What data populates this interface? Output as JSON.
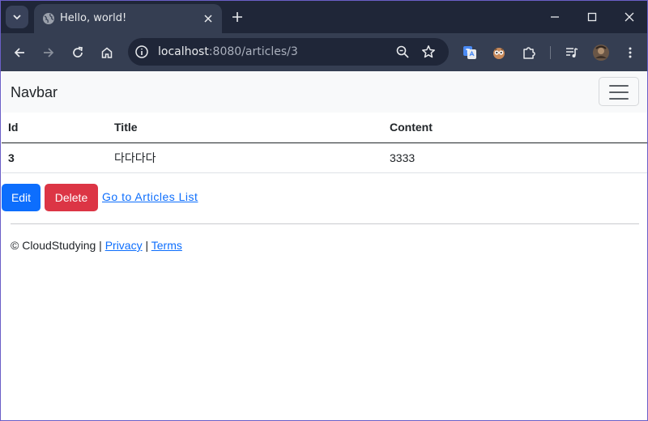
{
  "browser": {
    "tab_title": "Hello, world!",
    "url_host": "localhost",
    "url_path": ":8080/articles/3",
    "colors": {
      "tabstrip": "#1f2638",
      "toolbar": "#353e52",
      "omnibox": "#1f2638"
    }
  },
  "navbar": {
    "brand": "Navbar"
  },
  "table": {
    "headers": [
      "Id",
      "Title",
      "Content"
    ],
    "rows": [
      [
        "3",
        "다다다다",
        "3333"
      ]
    ]
  },
  "actions": {
    "edit_label": "Edit",
    "delete_label": "Delete",
    "list_link": "Go to Articles List",
    "colors": {
      "edit": "#0d6efd",
      "delete": "#dc3545"
    }
  },
  "footer": {
    "prefix": "© CloudStudying | ",
    "privacy": "Privacy",
    "separator": " | ",
    "terms": "Terms"
  }
}
